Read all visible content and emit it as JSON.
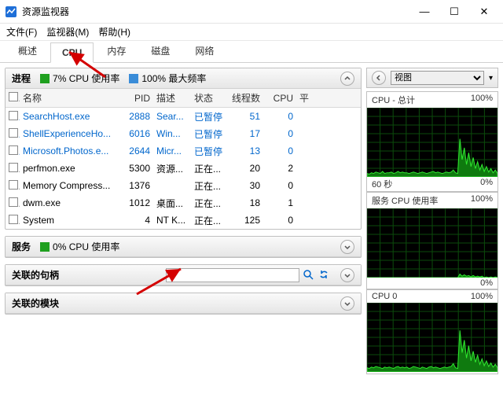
{
  "window": {
    "title": "资源监视器"
  },
  "winbtns": {
    "min": "—",
    "max": "☐",
    "close": "✕"
  },
  "menu": {
    "file": "文件(F)",
    "monitor": "监视器(M)",
    "help": "帮助(H)"
  },
  "tabs": {
    "overview": "概述",
    "cpu": "CPU",
    "memory": "内存",
    "disk": "磁盘",
    "network": "网络"
  },
  "proc_panel": {
    "title": "进程",
    "cpu_usage_label": "7% CPU 使用率",
    "max_freq_label": "100% 最大频率",
    "columns": {
      "name": "名称",
      "pid": "PID",
      "desc": "描述",
      "status": "状态",
      "threads": "线程数",
      "cpu": "CPU",
      "avg": "平"
    }
  },
  "processes": [
    {
      "name": "SearchHost.exe",
      "pid": "2888",
      "desc": "Sear...",
      "status": "已暂停",
      "threads": "51",
      "cpu": "0",
      "suspended": true
    },
    {
      "name": "ShellExperienceHo...",
      "pid": "6016",
      "desc": "Win...",
      "status": "已暂停",
      "threads": "17",
      "cpu": "0",
      "suspended": true
    },
    {
      "name": "Microsoft.Photos.e...",
      "pid": "2644",
      "desc": "Micr...",
      "status": "已暂停",
      "threads": "13",
      "cpu": "0",
      "suspended": true
    },
    {
      "name": "perfmon.exe",
      "pid": "5300",
      "desc": "资源...",
      "status": "正在...",
      "threads": "20",
      "cpu": "2",
      "suspended": false
    },
    {
      "name": "Memory Compress...",
      "pid": "1376",
      "desc": "",
      "status": "正在...",
      "threads": "30",
      "cpu": "0",
      "suspended": false
    },
    {
      "name": "dwm.exe",
      "pid": "1012",
      "desc": "桌面...",
      "status": "正在...",
      "threads": "18",
      "cpu": "1",
      "suspended": false
    },
    {
      "name": "System",
      "pid": "4",
      "desc": "NT K...",
      "status": "正在...",
      "threads": "125",
      "cpu": "0",
      "suspended": false
    }
  ],
  "services_panel": {
    "title": "服务",
    "cpu_usage_label": "0% CPU 使用率"
  },
  "handles_panel": {
    "title": "关联的句柄",
    "search_placeholder": ""
  },
  "modules_panel": {
    "title": "关联的模块"
  },
  "right": {
    "view_label": "视图",
    "charts": [
      {
        "title": "CPU - 总计",
        "right_top": "100%",
        "left_bot": "60 秒",
        "right_bot": "0%"
      },
      {
        "title": "服务 CPU 使用率",
        "right_top": "100%",
        "left_bot": "",
        "right_bot": "0%"
      },
      {
        "title": "CPU 0",
        "right_top": "100%",
        "left_bot": "",
        "right_bot": ""
      }
    ]
  },
  "chart_data": [
    {
      "type": "area",
      "title": "CPU - 总计",
      "ylim": [
        0,
        100
      ],
      "xrange_sec": 60,
      "values": [
        5,
        4,
        6,
        5,
        7,
        6,
        5,
        8,
        5,
        6,
        6,
        7,
        5,
        6,
        8,
        6,
        7,
        6,
        6,
        5,
        6,
        7,
        6,
        5,
        6,
        7,
        6,
        5,
        6,
        7,
        8,
        6,
        7,
        6,
        5,
        6,
        7,
        6,
        7,
        10,
        6,
        5,
        55,
        25,
        42,
        18,
        35,
        15,
        28,
        12,
        22,
        10,
        18,
        8,
        15,
        7,
        12,
        6,
        10,
        5
      ]
    },
    {
      "type": "area",
      "title": "服务 CPU 使用率",
      "ylim": [
        0,
        100
      ],
      "xrange_sec": 60,
      "values": [
        0,
        0,
        0,
        0,
        0,
        0,
        0,
        0,
        0,
        0,
        0,
        0,
        0,
        0,
        0,
        0,
        0,
        0,
        0,
        0,
        0,
        0,
        0,
        0,
        0,
        0,
        0,
        0,
        0,
        0,
        0,
        0,
        0,
        0,
        0,
        0,
        0,
        0,
        0,
        0,
        0,
        0,
        5,
        2,
        4,
        2,
        3,
        1,
        3,
        1,
        2,
        1,
        2,
        0,
        1,
        0,
        1,
        0,
        1,
        0
      ]
    },
    {
      "type": "area",
      "title": "CPU 0",
      "ylim": [
        0,
        100
      ],
      "xrange_sec": 60,
      "values": [
        6,
        5,
        7,
        6,
        8,
        7,
        6,
        5,
        7,
        6,
        7,
        6,
        5,
        7,
        8,
        6,
        7,
        6,
        7,
        5,
        6,
        8,
        7,
        6,
        5,
        7,
        6,
        5,
        7,
        8,
        6,
        7,
        6,
        5,
        6,
        7,
        6,
        7,
        8,
        12,
        6,
        5,
        60,
        28,
        46,
        20,
        38,
        16,
        30,
        14,
        24,
        11,
        19,
        9,
        16,
        8,
        13,
        7,
        11,
        6
      ]
    }
  ]
}
